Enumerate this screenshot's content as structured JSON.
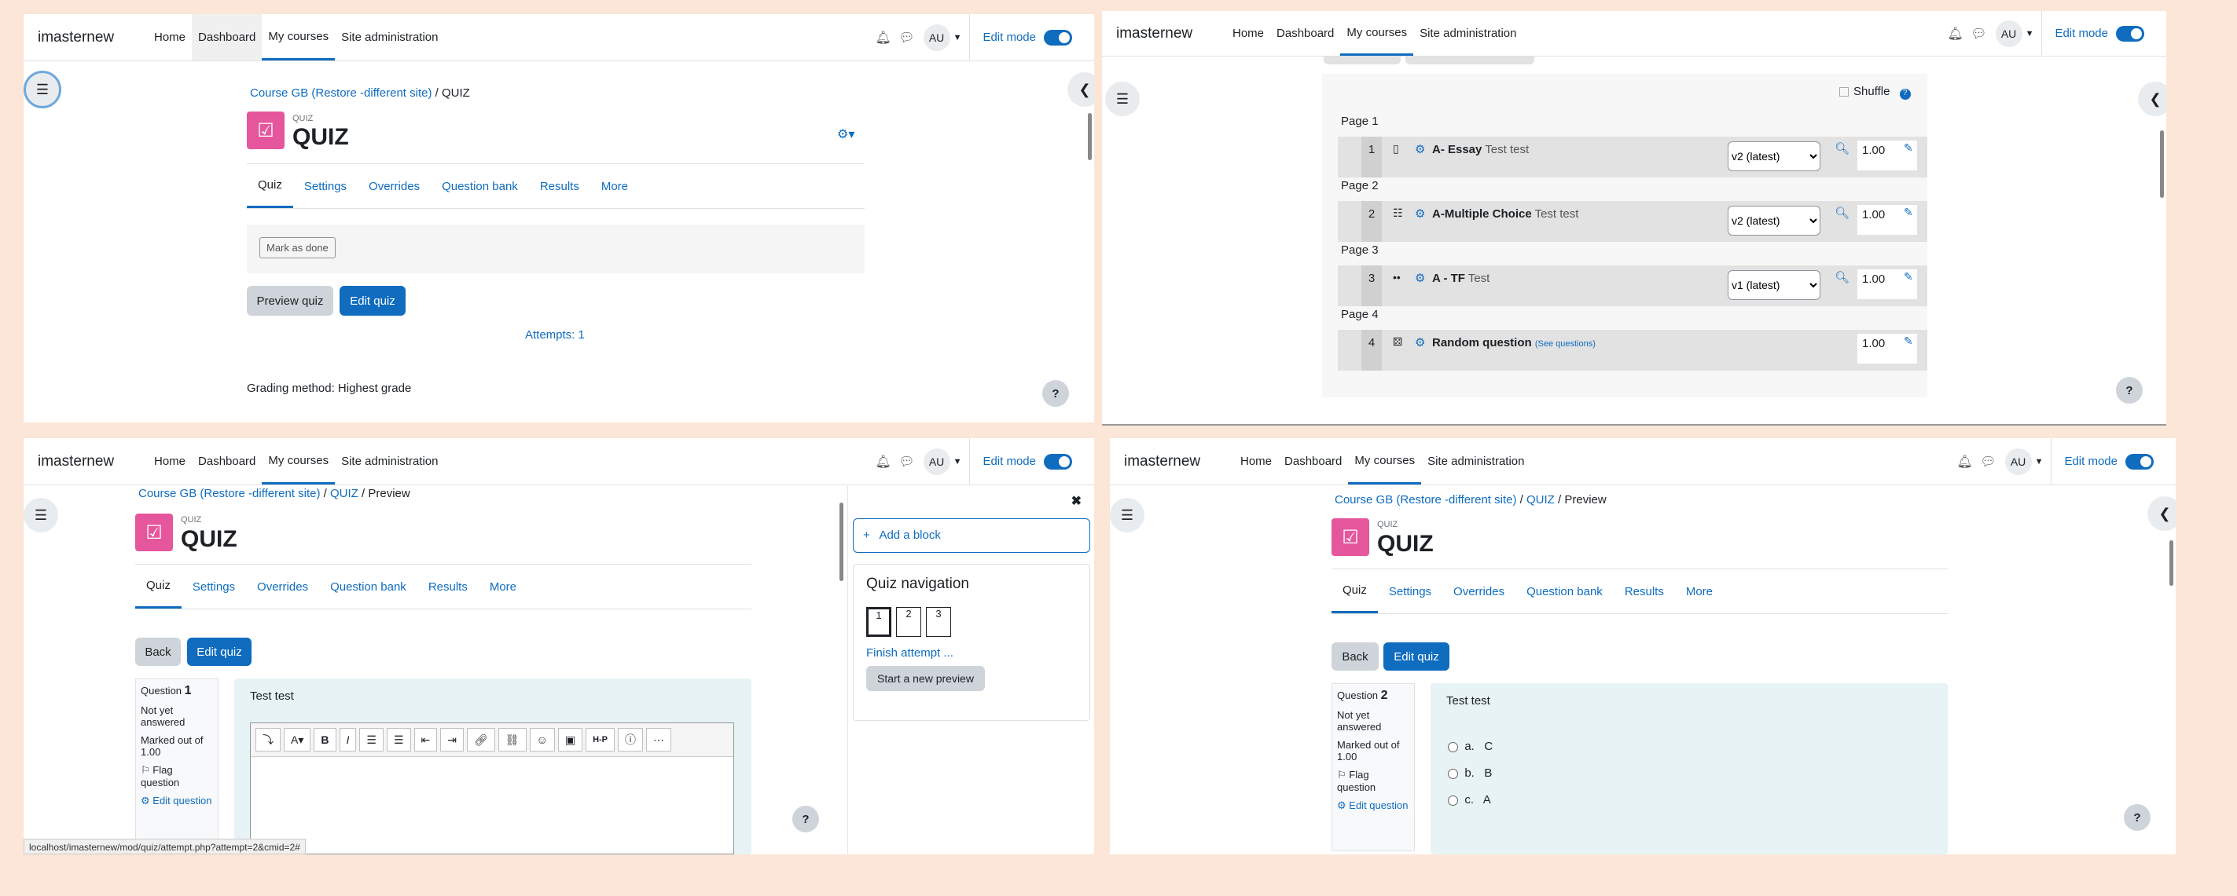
{
  "common": {
    "brand": "imasternew",
    "nav": [
      "Home",
      "Dashboard",
      "My courses",
      "Site administration"
    ],
    "avatar": "AU",
    "edit_mode": "Edit mode",
    "help": "?"
  },
  "panel1": {
    "breadcrumb_course": "Course GB (Restore -different site)",
    "breadcrumb_sep": "/",
    "breadcrumb_current": "QUIZ",
    "activity_type": "QUIZ",
    "title": "QUIZ",
    "tabs": [
      "Quiz",
      "Settings",
      "Overrides",
      "Question bank",
      "Results",
      "More"
    ],
    "mark_done": "Mark as done",
    "preview_quiz": "Preview quiz",
    "edit_quiz": "Edit quiz",
    "attempts": "Attempts: 1",
    "grading": "Grading method: Highest grade"
  },
  "panel2": {
    "shuffle": "Shuffle",
    "pages": [
      "Page 1",
      "Page 2",
      "Page 3",
      "Page 4"
    ],
    "slots": [
      {
        "num": "1",
        "name": "A- Essay",
        "text": "Test test",
        "version": "v2 (latest)",
        "mark": "1.00"
      },
      {
        "num": "2",
        "name": "A-Multiple Choice",
        "text": "Test test",
        "version": "v2 (latest)",
        "mark": "1.00"
      },
      {
        "num": "3",
        "name": "A - TF",
        "text": "Test",
        "version": "v1 (latest)",
        "mark": "1.00"
      },
      {
        "num": "4",
        "name": "Random question",
        "text": "(See questions)",
        "version": "",
        "mark": "1.00"
      }
    ]
  },
  "panel3": {
    "breadcrumb_course": "Course GB (Restore -different site)",
    "breadcrumb_quiz": "QUIZ",
    "breadcrumb_current": "Preview",
    "back": "Back",
    "edit_quiz": "Edit quiz",
    "question_label": "Question",
    "question_num": "1",
    "status": "Not yet answered",
    "marked": "Marked out of 1.00",
    "flag": "Flag question",
    "edit_q": "Edit question",
    "question_text": "Test test",
    "add_block": "Add a block",
    "quiz_nav": "Quiz navigation",
    "nav_buttons": [
      "1",
      "2",
      "3"
    ],
    "finish": "Finish attempt ...",
    "new_preview": "Start a new preview",
    "status_url": "localhost/imasternew/mod/quiz/attempt.php?attempt=2&cmid=2#"
  },
  "panel4": {
    "question_num": "2",
    "options": [
      {
        "letter": "a.",
        "text": "C"
      },
      {
        "letter": "b.",
        "text": "B"
      },
      {
        "letter": "c.",
        "text": "A"
      }
    ]
  }
}
